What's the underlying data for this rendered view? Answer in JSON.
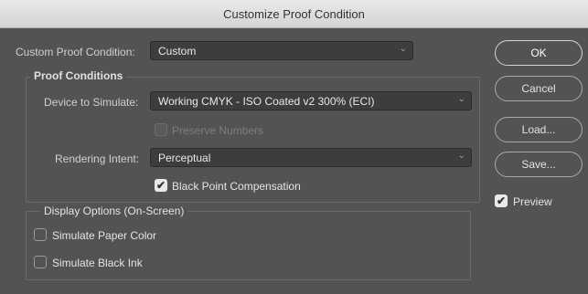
{
  "window": {
    "title": "Customize Proof Condition"
  },
  "custom_condition": {
    "label": "Custom Proof Condition:",
    "value": "Custom"
  },
  "proof_conditions": {
    "legend": "Proof Conditions",
    "device_label": "Device to Simulate:",
    "device_value": "Working CMYK - ISO Coated v2 300% (ECI)",
    "preserve_numbers": {
      "label": "Preserve Numbers",
      "checked": false,
      "enabled": false
    },
    "rendering_label": "Rendering Intent:",
    "rendering_value": "Perceptual",
    "black_point": {
      "label": "Black Point Compensation",
      "checked": true
    }
  },
  "display_options": {
    "legend": "Display Options (On-Screen)",
    "paper_color": {
      "label": "Simulate Paper Color",
      "checked": false
    },
    "black_ink": {
      "label": "Simulate Black Ink",
      "checked": false
    }
  },
  "buttons": {
    "ok": "OK",
    "cancel": "Cancel",
    "load": "Load...",
    "save": "Save..."
  },
  "preview": {
    "label": "Preview",
    "checked": true
  },
  "icons": {
    "check": "✔",
    "chevron": "⌄"
  },
  "colors": {
    "background": "#535353",
    "titlebar": "#dcdcdc",
    "field": "#3d3d3d"
  }
}
